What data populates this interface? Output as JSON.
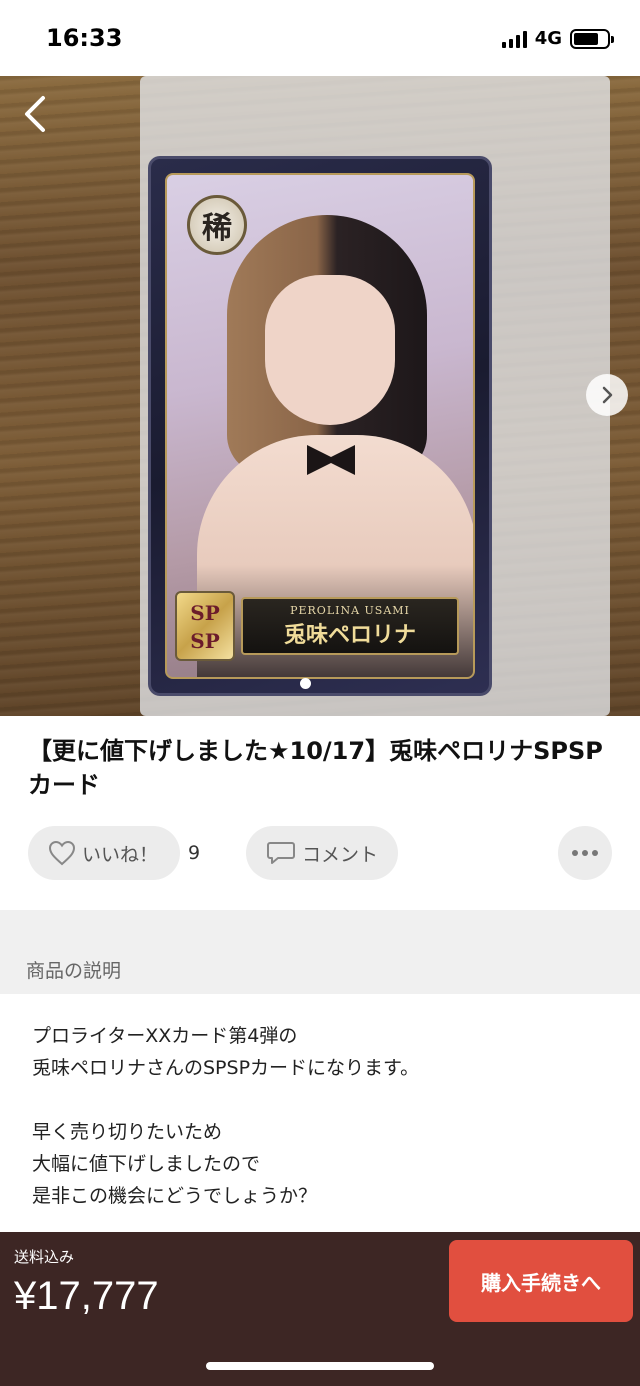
{
  "status_bar": {
    "time": "16:33",
    "network": "4G"
  },
  "product": {
    "title": "【更に値下げしました★10/17】兎味ペロリナSPSPカード",
    "card": {
      "rarity": "稀",
      "sp_top": "SP",
      "sp_bottom": "SP",
      "name_romaji": "PEROLINA USAMI",
      "name_jp": "兎味ペロリナ"
    }
  },
  "actions": {
    "like_label": "いいね！",
    "like_count": "9",
    "comment_label": "コメント"
  },
  "description": {
    "section_title": "商品の説明",
    "lines": [
      "プロライターXXカード第4弾の",
      "兎味ペロリナさんのSPSPカードになります。",
      "",
      "早く売り切りたいため",
      "大幅に値下げしましたので",
      "是非この機会にどうでしょうか？"
    ]
  },
  "purchase": {
    "shipping_label": "送料込み",
    "price": "¥17,777",
    "buy_label": "購入手続きへ"
  },
  "colors": {
    "bottom_bar": "#3d2624",
    "buy_button": "#e14f3f"
  },
  "icons": {
    "back": "chevron-left-icon",
    "next": "chevron-right-icon",
    "like": "heart-icon",
    "comment": "speech-bubble-icon",
    "more": "more-dots-icon"
  }
}
